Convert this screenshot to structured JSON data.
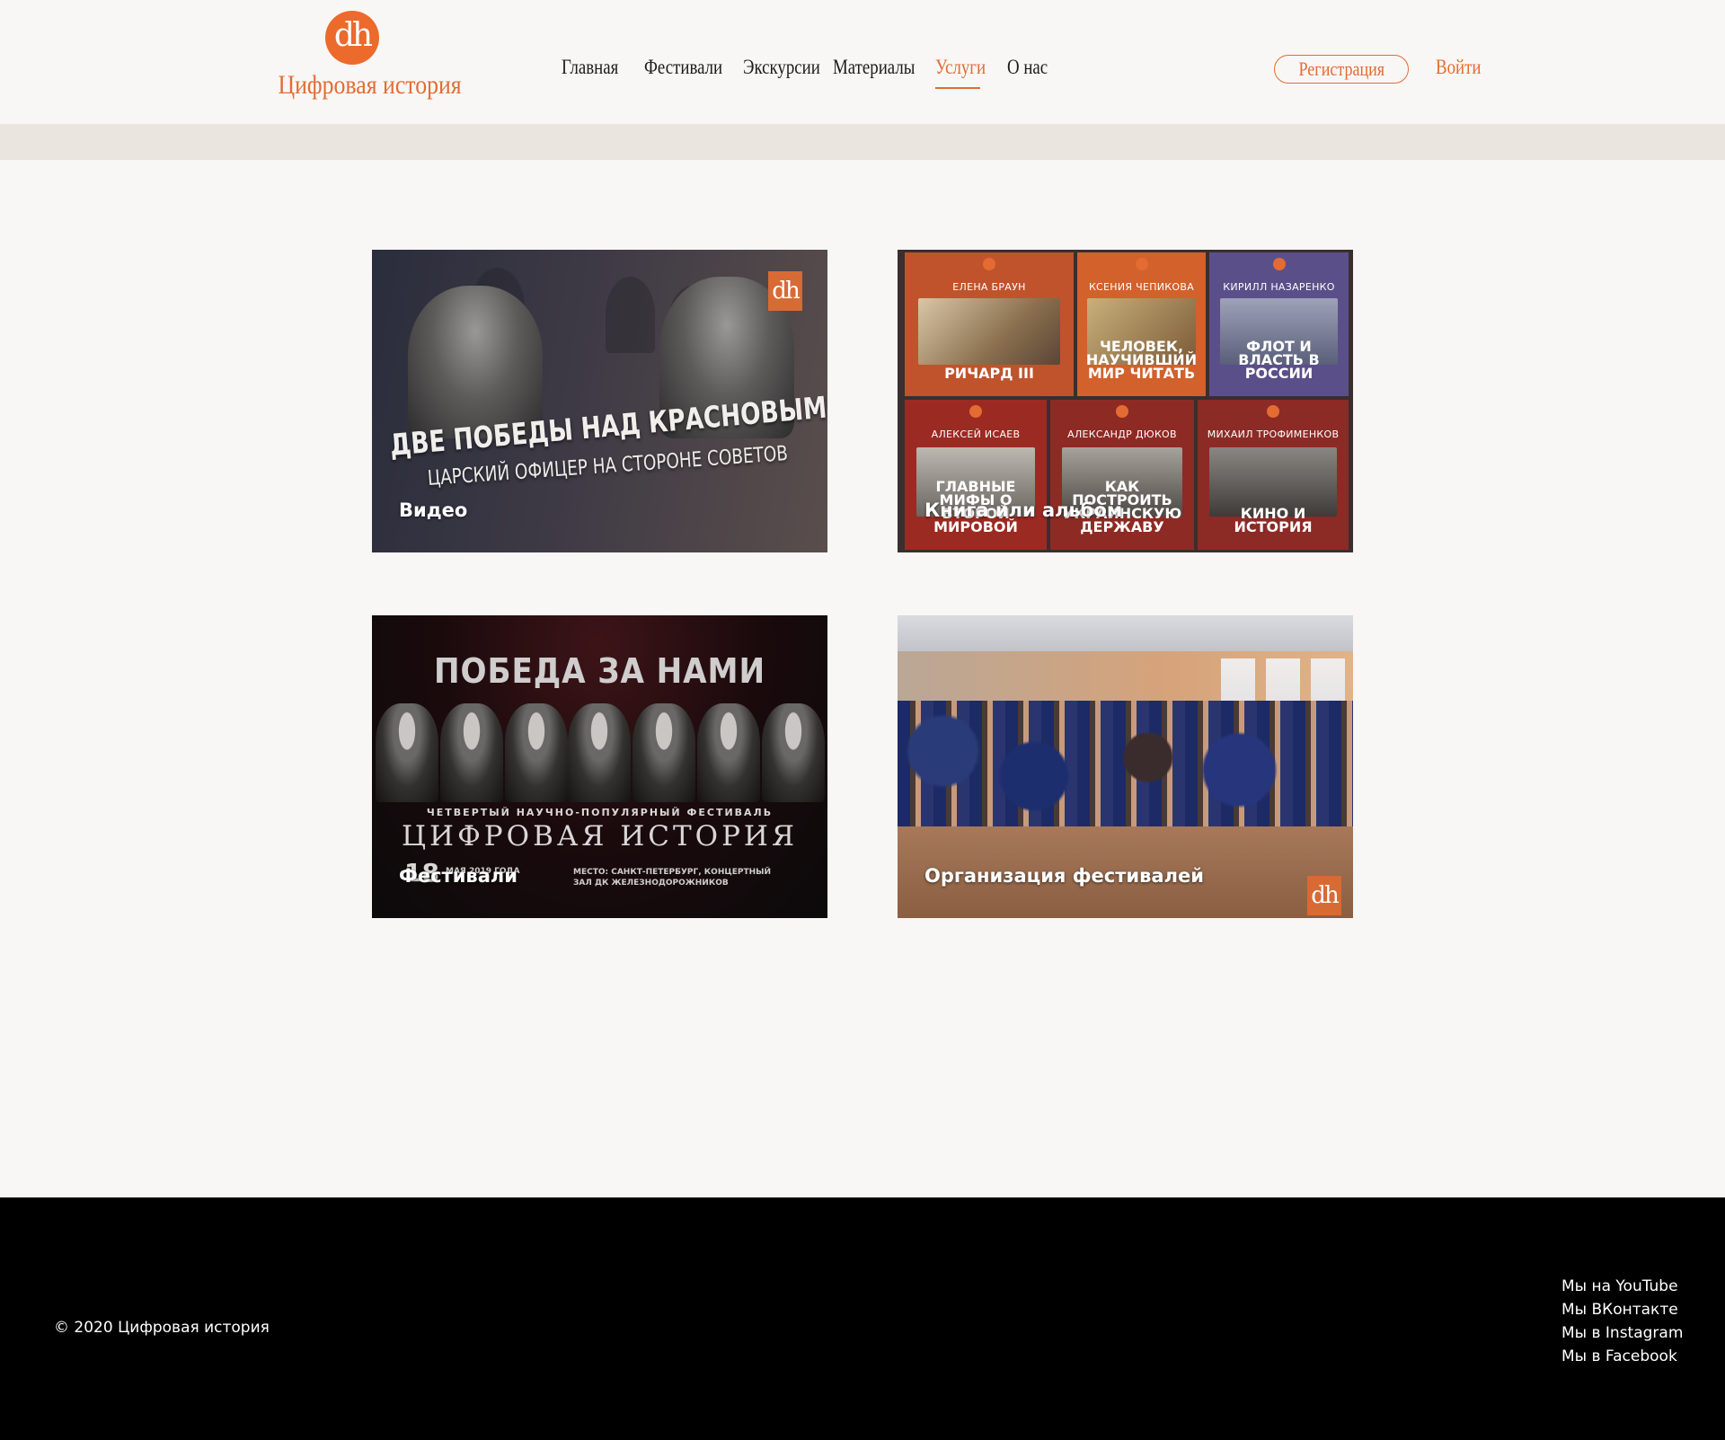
{
  "header": {
    "logo_mark": "dh",
    "logo_text": "Цифровая история",
    "nav": [
      "Главная",
      "Фестивали",
      "Экскурсии",
      "Материалы",
      "Услуги",
      "О нас"
    ],
    "active_nav": "Услуги",
    "register_label": "Регистрация",
    "login_label": "Войти"
  },
  "colors": {
    "accent": "#e46b32",
    "page_bg": "#f8f7f6",
    "band_bg": "#ebe5e0",
    "footer_bg": "#000000"
  },
  "cards": [
    {
      "label": "Видео",
      "image": {
        "title": "ДВЕ ПОБЕДЫ НАД КРАСНОВЫМ:",
        "subtitle": "ЦАРСКИЙ ОФИЦЕР НА СТОРОНЕ СОВЕТОВ",
        "badge": "dh"
      }
    },
    {
      "label": "Книга или альбом",
      "books": [
        {
          "author": "ЕЛЕНА БРАУН",
          "title": "РИЧАРД III",
          "color": "#c0532c"
        },
        {
          "author": "КСЕНИЯ ЧЕПИКОВА",
          "title": "ЧЕЛОВЕК, НАУЧИВШИЙ МИР ЧИТАТЬ",
          "color": "#d2612b"
        },
        {
          "author": "КИРИЛЛ НАЗАРЕНКО",
          "title": "ФЛОТ И ВЛАСТЬ В РОССИИ",
          "color": "#5b4f8a"
        },
        {
          "author": "АЛЕКСЕЙ ИСАЕВ",
          "title": "ГЛАВНЫЕ МИФЫ О ВТОРОЙ МИРОВОЙ",
          "color": "#9b2a22"
        },
        {
          "author": "АЛЕКСАНДР ДЮКОВ",
          "title": "КАК ПОСТРОИТЬ УКРАИНСКУЮ ДЕРЖАВУ",
          "color": "#8e2a24"
        },
        {
          "author": "МИХАИЛ ТРОФИМЕНКОВ",
          "title": "КИНО И ИСТОРИЯ",
          "color": "#8c2a26"
        }
      ]
    },
    {
      "label": "Фестивали",
      "image": {
        "headline": "ПОБЕДА ЗА НАМИ",
        "small": "ЧЕТВЕРТЫЙ НАУЧНО-ПОПУЛЯРНЫЙ ФЕСТИВАЛЬ",
        "big": "ЦИФРОВАЯ ИСТОРИЯ",
        "day": "18",
        "date": "МАЯ 2019 ГОДА",
        "place": "МЕСТО: САНКТ-ПЕТЕРБУРГ, КОНЦЕРТНЫЙ ЗАЛ ДК ЖЕЛЕЗНОДОРОЖНИКОВ"
      }
    },
    {
      "label": "Организация фестивалей",
      "image": {
        "badge": "dh"
      }
    }
  ],
  "footer": {
    "copyright": "© 2020 Цифровая история",
    "social": [
      "Мы на YouTube",
      "Мы ВКонтакте",
      "Мы в Instagram",
      "Мы в Facebook"
    ]
  }
}
